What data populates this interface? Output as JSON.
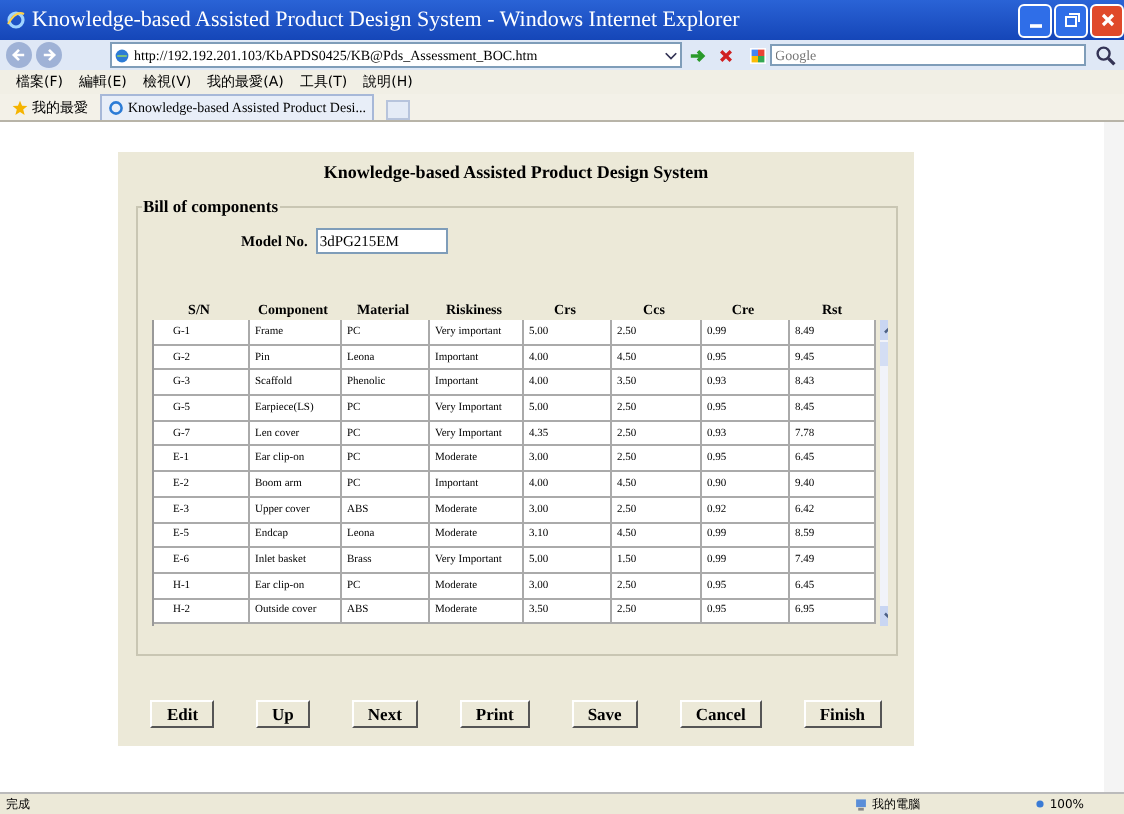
{
  "window": {
    "title": "Knowledge-based Assisted Product Design System - Windows Internet Explorer"
  },
  "address_bar": {
    "url": "http://192.192.201.103/KbAPDS0425/KB@Pds_Assessment_BOC.htm",
    "search_placeholder": "Google"
  },
  "menu": [
    "檔案(F)",
    "編輯(E)",
    "檢視(V)",
    "我的最愛(A)",
    "工具(T)",
    "說明(H)"
  ],
  "favorites_bar": {
    "favorites": "我的最愛",
    "tab": "Knowledge-based Assisted Product Desi..."
  },
  "page": {
    "heading": "Knowledge-based Assisted Product Design System",
    "legend": "Bill of components",
    "model_label": "Model No.",
    "model_value": "3dPG215EM"
  },
  "table": {
    "columns": [
      "S/N",
      "Component",
      "Material",
      "Riskiness",
      "Crs",
      "Ccs",
      "Cre",
      "Rst"
    ],
    "rows": [
      [
        "G-1",
        "Frame",
        "PC",
        "Very important",
        "5.00",
        "2.50",
        "0.99",
        "8.49"
      ],
      [
        "G-2",
        "Pin",
        "Leona",
        "Important",
        "4.00",
        "4.50",
        "0.95",
        "9.45"
      ],
      [
        "G-3",
        "Scaffold",
        "Phenolic",
        "Important",
        "4.00",
        "3.50",
        "0.93",
        "8.43"
      ],
      [
        "G-5",
        "Earpiece(LS)",
        "PC",
        "Very Important",
        "5.00",
        "2.50",
        "0.95",
        "8.45"
      ],
      [
        "G-7",
        "Len cover",
        "PC",
        "Very Important",
        "4.35",
        "2.50",
        "0.93",
        "7.78"
      ],
      [
        "E-1",
        "Ear clip-on",
        "PC",
        "Moderate",
        "3.00",
        "2.50",
        "0.95",
        "6.45"
      ],
      [
        "E-2",
        "Boom arm",
        "PC",
        "Important",
        "4.00",
        "4.50",
        "0.90",
        "9.40"
      ],
      [
        "E-3",
        "Upper cover",
        "ABS",
        "Moderate",
        "3.00",
        "2.50",
        "0.92",
        "6.42"
      ],
      [
        "E-5",
        "Endcap",
        "Leona",
        "Moderate",
        "3.10",
        "4.50",
        "0.99",
        "8.59"
      ],
      [
        "E-6",
        "Inlet basket",
        "Brass",
        "Very Important",
        "5.00",
        "1.50",
        "0.99",
        "7.49"
      ],
      [
        "H-1",
        "Ear clip-on",
        "PC",
        "Moderate",
        "3.00",
        "2.50",
        "0.95",
        "6.45"
      ],
      [
        "H-2",
        "Outside cover",
        "ABS",
        "Moderate",
        "3.50",
        "2.50",
        "0.95",
        "6.95"
      ]
    ]
  },
  "buttons": [
    "Edit",
    "Up",
    "Next",
    "Print",
    "Save",
    "Cancel",
    "Finish"
  ],
  "status_bar": {
    "status": "完成",
    "zone": "我的電腦",
    "zoom": "100%"
  }
}
